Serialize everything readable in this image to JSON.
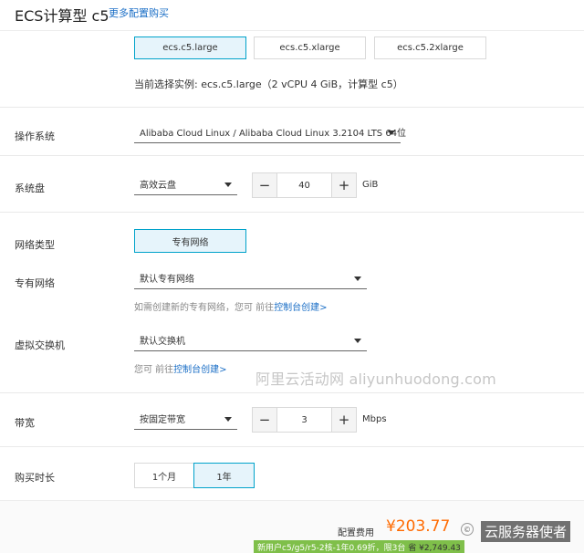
{
  "header": {
    "title": "ECS计算型 c5",
    "more_link": "更多配置购买"
  },
  "instance_types": {
    "options": [
      "ecs.c5.large",
      "ecs.c5.xlarge",
      "ecs.c5.2xlarge"
    ],
    "selected_index": 0,
    "current_selection": "当前选择实例: ecs.c5.large（2 vCPU 4 GiB，计算型 c5）"
  },
  "os": {
    "label": "操作系统",
    "value": "Alibaba Cloud Linux / Alibaba Cloud Linux 3.2104 LTS 64位"
  },
  "disk": {
    "label": "系统盘",
    "type": "高效云盘",
    "size": "40",
    "unit": "GiB",
    "minus": "−",
    "plus": "+"
  },
  "network_type": {
    "label": "网络类型",
    "option": "专有网络"
  },
  "vpc": {
    "label": "专有网络",
    "value": "默认专有网络",
    "hint_prefix": "如需创建新的专有网络，您可 前往",
    "hint_link": "控制台创建>"
  },
  "vswitch": {
    "label": "虚拟交换机",
    "value": "默认交换机",
    "hint_prefix": "您可 前往",
    "hint_link": "控制台创建>"
  },
  "watermark": "阿里云活动网 aliyunhuodong.com",
  "bandwidth": {
    "label": "带宽",
    "mode": "按固定带宽",
    "value": "3",
    "unit": "Mbps",
    "minus": "−",
    "plus": "+"
  },
  "duration": {
    "label": "购买时长",
    "options": [
      "1个月",
      "1年"
    ],
    "selected_index": 1
  },
  "footer": {
    "fee_label": "配置费用",
    "price": "¥203.77",
    "promo": "新用户c5/g5/r5-2核-1年0.69折，限3台",
    "save_prefix": "省",
    "save_amount": "¥2,749.43",
    "brand_watermark": "云服务器使者"
  }
}
